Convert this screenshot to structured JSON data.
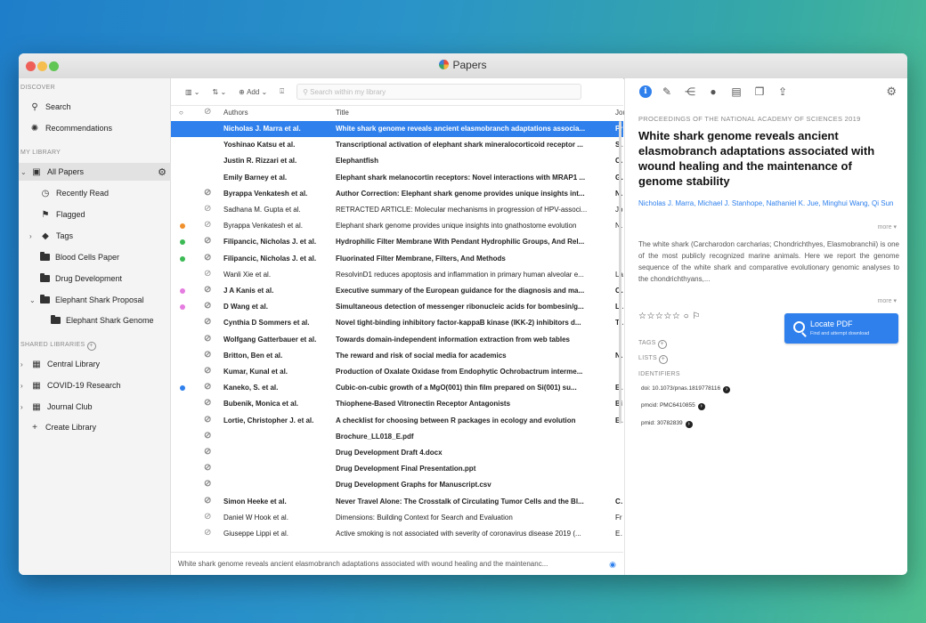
{
  "app": {
    "title": "Papers"
  },
  "sidebar": {
    "discover_heading": "DISCOVER",
    "search": "Search",
    "recommendations": "Recommendations",
    "my_library_heading": "MY LIBRARY",
    "all_papers": "All Papers",
    "recently_read": "Recently Read",
    "flagged": "Flagged",
    "tags": "Tags",
    "blood_cells": "Blood Cells Paper",
    "drug_development": "Drug Development",
    "elephant_shark_proposal": "Elephant Shark Proposal",
    "elephant_shark_genome": "Elephant Shark Genome",
    "shared_heading": "SHARED LIBRARIES",
    "central_library": "Central Library",
    "covid": "COVID-19 Research",
    "journal_club": "Journal Club",
    "create_library": "Create Library"
  },
  "toolbar": {
    "add_label": "Add",
    "search_placeholder": "Search within my library"
  },
  "table": {
    "headers": {
      "authors": "Authors",
      "title": "Title",
      "journal": "Jou"
    },
    "rows": [
      {
        "author": "Nicholas J. Marra et al.",
        "title": "White shark genome reveals ancient elasmobranch adaptations associa...",
        "journal": "Pr"
      },
      {
        "author": "Yoshinao Katsu et al.",
        "title": "Transcriptional activation of elephant shark mineralocorticoid receptor ...",
        "journal": "Sc"
      },
      {
        "author": "Justin R. Rizzari et al.",
        "title": "Elephantfish",
        "journal": "Cu"
      },
      {
        "author": "Emily Barney et al.",
        "title": "Elephant shark melanocortin receptors: Novel interactions with MRAP1 ...",
        "journal": "Ge"
      },
      {
        "author": "Byrappa Venkatesh et al.",
        "title": "Author Correction: Elephant shark genome provides unique insights int...",
        "journal": "Na"
      },
      {
        "author": "Sadhana M. Gupta et al.",
        "title": "RETRACTED ARTICLE: Molecular mechanisms in progression of HPV-associ...",
        "journal": "Jo"
      },
      {
        "author": "Byrappa Venkatesh et al.",
        "title": "Elephant shark genome provides unique insights into gnathostome evolution",
        "journal": "Na"
      },
      {
        "author": "Filipancic, Nicholas J. et al.",
        "title": "Hydrophilic Filter Membrane With Pendant Hydrophilic Groups, And Rel...",
        "journal": ""
      },
      {
        "author": "Filipancic, Nicholas J. et al.",
        "title": "Fluorinated Filter Membrane, Filters, And Methods",
        "journal": ""
      },
      {
        "author": "Wanli Xie et al.",
        "title": "ResolvinD1 reduces apoptosis and inflammation in primary human alveolar e...",
        "journal": "La"
      },
      {
        "author": "J A Kanis et al.",
        "title": "Executive summary of the European guidance for the diagnosis and ma...",
        "journal": "Os"
      },
      {
        "author": "D Wang et al.",
        "title": "Simultaneous detection of messenger ribonucleic acids for bombesin/g...",
        "journal": "La"
      },
      {
        "author": "Cynthia D Sommers et al.",
        "title": "Novel tight-binding inhibitory factor-kappaB kinase (IKK-2) inhibitors d...",
        "journal": "Th"
      },
      {
        "author": "Wolfgang Gatterbauer et al.",
        "title": "Towards domain-independent information extraction from web tables",
        "journal": ""
      },
      {
        "author": "Britton, Ben et al.",
        "title": "The reward and risk of social media for academics",
        "journal": "Na"
      },
      {
        "author": "Kumar, Kunal et al.",
        "title": "Production of Oxalate Oxidase from Endophytic Ochrobactrum interme...",
        "journal": ""
      },
      {
        "author": "Kaneko, S. et al.",
        "title": "Cubic-on-cubic growth of a MgO(001) thin film prepared on Si(001) su...",
        "journal": "EF"
      },
      {
        "author": "Bubenik, Monica et al.",
        "title": "Thiophene-Based Vitronectin Receptor Antagonists",
        "journal": "Bi"
      },
      {
        "author": "Lortie, Christopher J. et al.",
        "title": "A checklist for choosing between R packages in ecology and evolution",
        "journal": "Ec"
      },
      {
        "author": "",
        "title": "Brochure_LL018_E.pdf",
        "journal": ""
      },
      {
        "author": "",
        "title": "Drug Development Draft 4.docx",
        "journal": ""
      },
      {
        "author": "",
        "title": "Drug Development Final Presentation.ppt",
        "journal": ""
      },
      {
        "author": "",
        "title": "Drug Development Graphs for Manuscript.csv",
        "journal": ""
      },
      {
        "author": "Simon Heeke et al.",
        "title": "Never Travel Alone: The Crosstalk of Circulating Tumor Cells and the Bl...",
        "journal": "Ca"
      },
      {
        "author": "Daniel W Hook et al.",
        "title": "Dimensions: Building Context for Search and Evaluation",
        "journal": "Fr"
      },
      {
        "author": "Giuseppe Lippi et al.",
        "title": "Active smoking is not associated with severity of coronavirus disease 2019 (...",
        "journal": "Eu"
      }
    ],
    "dot_colors": {
      "orange": "#f0902d",
      "green": "#3cba54",
      "pink": "#e57ce0",
      "blue": "#2f80ed"
    }
  },
  "status_bar": {
    "text": "White shark genome reveals ancient elasmobranch adaptations associated with wound healing and the maintenanc..."
  },
  "detail": {
    "journal": "PROCEEDINGS OF THE NATIONAL ACADEMY OF SCIENCES 2019",
    "title": "White shark genome reveals ancient elasmobranch adaptations associated with wound healing and the maintenance of genome stability",
    "authors": "Nicholas J. Marra, Michael J. Stanhope, Nathaniel K. Jue, Minghui Wang, Qi Sun",
    "more_label": "more",
    "abstract": "The white shark (Carcharodon carcharias; Chondrichthyes, Elasmobranchii) is one of the most publicly recognized marine animals. Here we report the genome sequence of the white shark and comparative evolutionary genomic analyses to the chondrichthyans,...",
    "locate_pdf": "Locate PDF",
    "locate_pdf_sub": "Find and attempt download",
    "tags_label": "TAGS",
    "lists_label": "LISTS",
    "identifiers_label": "IDENTIFIERS",
    "doi": "doi: 10.1073/pnas.1819778116",
    "pmcid": "pmcid: PMC6410855",
    "pmid": "pmid: 30782839"
  },
  "colors": {
    "accent": "#2f80ed"
  }
}
